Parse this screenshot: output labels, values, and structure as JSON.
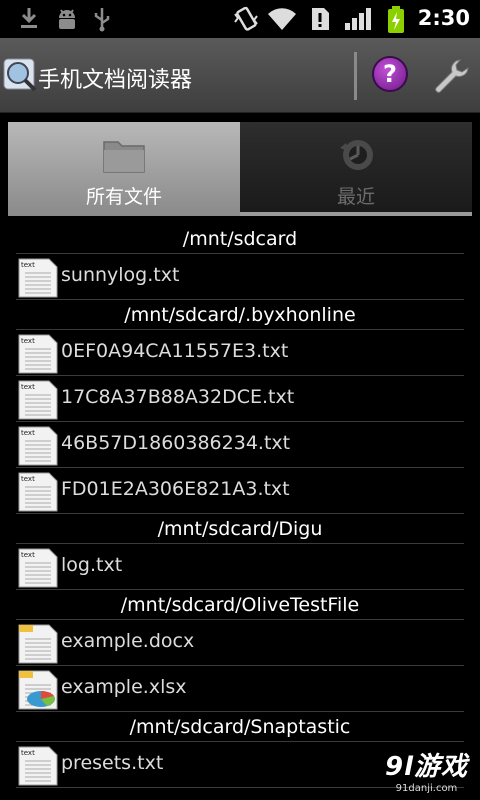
{
  "status_bar": {
    "time": "2:30",
    "icons": [
      "download-icon",
      "android-debug-icon",
      "usb-icon",
      "vibrate-icon",
      "wifi-icon",
      "alert-icon",
      "signal-icon",
      "battery-charging-icon"
    ]
  },
  "title_bar": {
    "title": "手机文档阅读器",
    "help_label": "?",
    "icons": [
      "app-icon",
      "help-icon",
      "settings-wrench-icon"
    ]
  },
  "tabs": [
    {
      "label": "所有文件",
      "icon": "folder-icon",
      "selected": true
    },
    {
      "label": "最近",
      "icon": "recent-icon",
      "selected": false
    }
  ],
  "groups": [
    {
      "path": "/mnt/sdcard",
      "files": [
        {
          "name": "sunnylog.txt",
          "type": "text"
        }
      ]
    },
    {
      "path": "/mnt/sdcard/.byxhonline",
      "files": [
        {
          "name": "0EF0A94CA11557E3.txt",
          "type": "text"
        },
        {
          "name": "17C8A37B88A32DCE.txt",
          "type": "text"
        },
        {
          "name": "46B57D1860386234.txt",
          "type": "text"
        },
        {
          "name": "FD01E2A306E821A3.txt",
          "type": "text"
        }
      ]
    },
    {
      "path": "/mnt/sdcard/Digu",
      "files": [
        {
          "name": "log.txt",
          "type": "text"
        }
      ]
    },
    {
      "path": "/mnt/sdcard/OliveTestFile",
      "files": [
        {
          "name": "example.docx",
          "type": "docx"
        },
        {
          "name": "example.xlsx",
          "type": "xlsx"
        }
      ]
    },
    {
      "path": "/mnt/sdcard/Snaptastic",
      "files": [
        {
          "name": "presets.txt",
          "type": "text"
        }
      ]
    }
  ],
  "file_icon_label": "text",
  "watermark": {
    "logo": "9l游戏",
    "url": "91danji.com"
  },
  "colors": {
    "background": "#000000",
    "titlebar": "#4a4a4a",
    "tab_selected": "#a0a0a0",
    "help_purple": "#8a2aa8",
    "battery_green": "#8cd000"
  }
}
